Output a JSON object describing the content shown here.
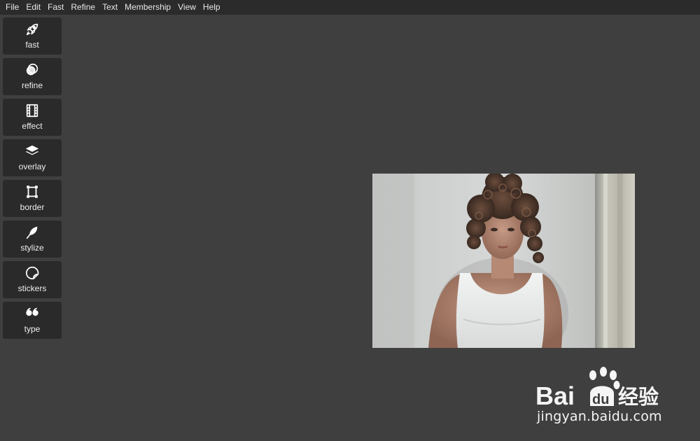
{
  "menubar": {
    "items": [
      {
        "label": "File"
      },
      {
        "label": "Edit"
      },
      {
        "label": "Fast"
      },
      {
        "label": "Refine"
      },
      {
        "label": "Text"
      },
      {
        "label": "Membership"
      },
      {
        "label": "View"
      },
      {
        "label": "Help"
      }
    ]
  },
  "sidebar": {
    "tools": [
      {
        "label": "fast",
        "icon": "rocket-icon"
      },
      {
        "label": "refine",
        "icon": "overlapping-circles-icon"
      },
      {
        "label": "effect",
        "icon": "film-icon"
      },
      {
        "label": "overlay",
        "icon": "layers-icon"
      },
      {
        "label": "border",
        "icon": "frame-icon"
      },
      {
        "label": "stylize",
        "icon": "feather-icon"
      },
      {
        "label": "stickers",
        "icon": "sticker-icon"
      },
      {
        "label": "type",
        "icon": "quote-icon"
      }
    ]
  },
  "watermark": {
    "logo_text": "Bai du 经验",
    "url": "jingyan.baidu.com"
  },
  "colors": {
    "background": "#3f3f3f",
    "menubar": "#2b2b2b",
    "tool_button": "#2a2a2a",
    "text": "#ededed"
  }
}
